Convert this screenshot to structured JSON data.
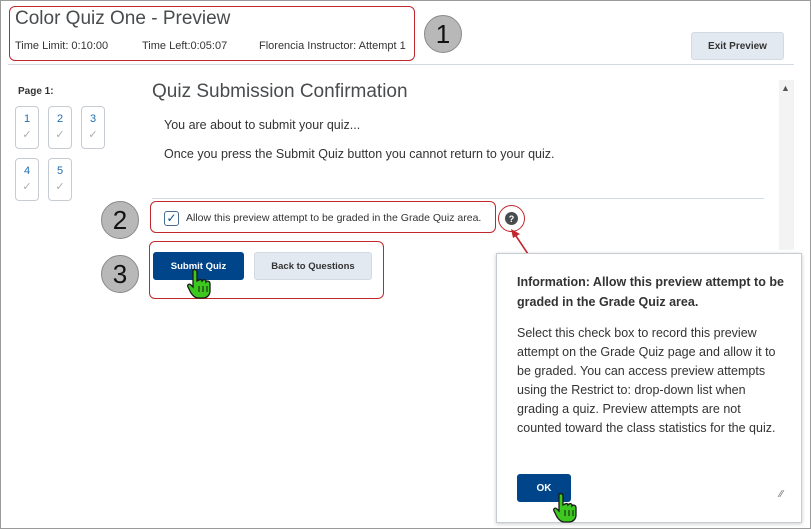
{
  "header": {
    "title": "Color Quiz One - Preview",
    "time_limit": "Time Limit: 0:10:00",
    "time_left": "Time Left:0:05:07",
    "attempt": "Florencia Instructor: Attempt 1",
    "exit_label": "Exit Preview"
  },
  "callouts": [
    "1",
    "2",
    "3"
  ],
  "page_nav": {
    "label": "Page 1:",
    "items": [
      {
        "number": "1",
        "answered": true
      },
      {
        "number": "2",
        "answered": true
      },
      {
        "number": "3",
        "answered": true
      },
      {
        "number": "4",
        "answered": true
      },
      {
        "number": "5",
        "answered": true
      }
    ],
    "check_glyph": "✓"
  },
  "main": {
    "title": "Quiz Submission Confirmation",
    "line1": "You are about to submit your quiz...",
    "line2": "Once you press the Submit Quiz button you cannot return to your quiz.",
    "checkbox_checked": true,
    "checkbox_label": "Allow this preview attempt to be graded in the Grade Quiz area.",
    "help_icon": "question-icon",
    "submit_label": "Submit Quiz",
    "back_label": "Back to Questions"
  },
  "popup": {
    "title": "Information: Allow this preview attempt to be graded in the Grade Quiz area.",
    "body": "Select this check box to record this preview attempt on the Grade Quiz page and allow it to be graded. You can access preview attempts using the Restrict to: drop-down list when grading a quiz. Preview attempts are not counted toward the class statistics for the quiz.",
    "ok_label": "OK"
  },
  "colors": {
    "callout_red": "#c0282e",
    "primary_blue": "#004489",
    "link_blue": "#1f6fb2",
    "cursor_green": "#3cc81e"
  }
}
